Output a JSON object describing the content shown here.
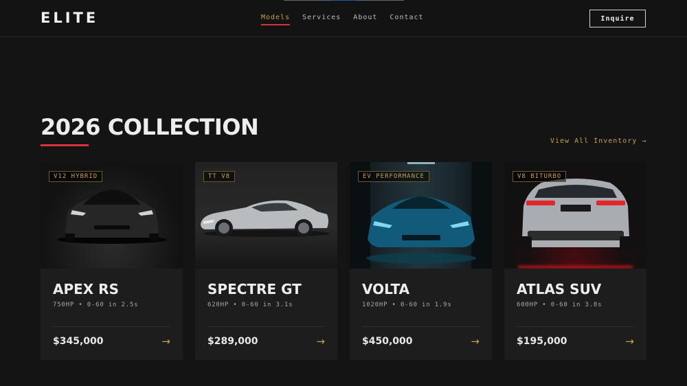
{
  "brand": {
    "logo": "ELITE"
  },
  "nav": {
    "items": [
      {
        "label": "Models",
        "active": true
      },
      {
        "label": "Services",
        "active": false
      },
      {
        "label": "About",
        "active": false
      },
      {
        "label": "Contact",
        "active": false
      }
    ],
    "inquire_label": "Inquire"
  },
  "section": {
    "title": "2026 COLLECTION",
    "view_all": "View All Inventory →"
  },
  "cards": [
    {
      "badge": "V12 HYBRID",
      "name": "APEX RS",
      "specs": "750HP • 0-60 in 2.5s",
      "price": "$345,000",
      "arrow": "→"
    },
    {
      "badge": "TT V8",
      "name": "SPECTRE GT",
      "specs": "620HP • 0-60 in 3.1s",
      "price": "$289,000",
      "arrow": "→"
    },
    {
      "badge": "EV PERFORMANCE",
      "name": "VOLTA",
      "specs": "1020HP • 0-60 in 1.9s",
      "price": "$450,000",
      "arrow": "→"
    },
    {
      "badge": "V8 BITURBO",
      "name": "ATLAS SUV",
      "specs": "600HP • 0-60 in 3.8s",
      "price": "$195,000",
      "arrow": "→"
    }
  ],
  "colors": {
    "background": "#141414",
    "accent_gold": "#c9a04a",
    "accent_red": "#d8333c",
    "card": "#1d1d1d"
  }
}
